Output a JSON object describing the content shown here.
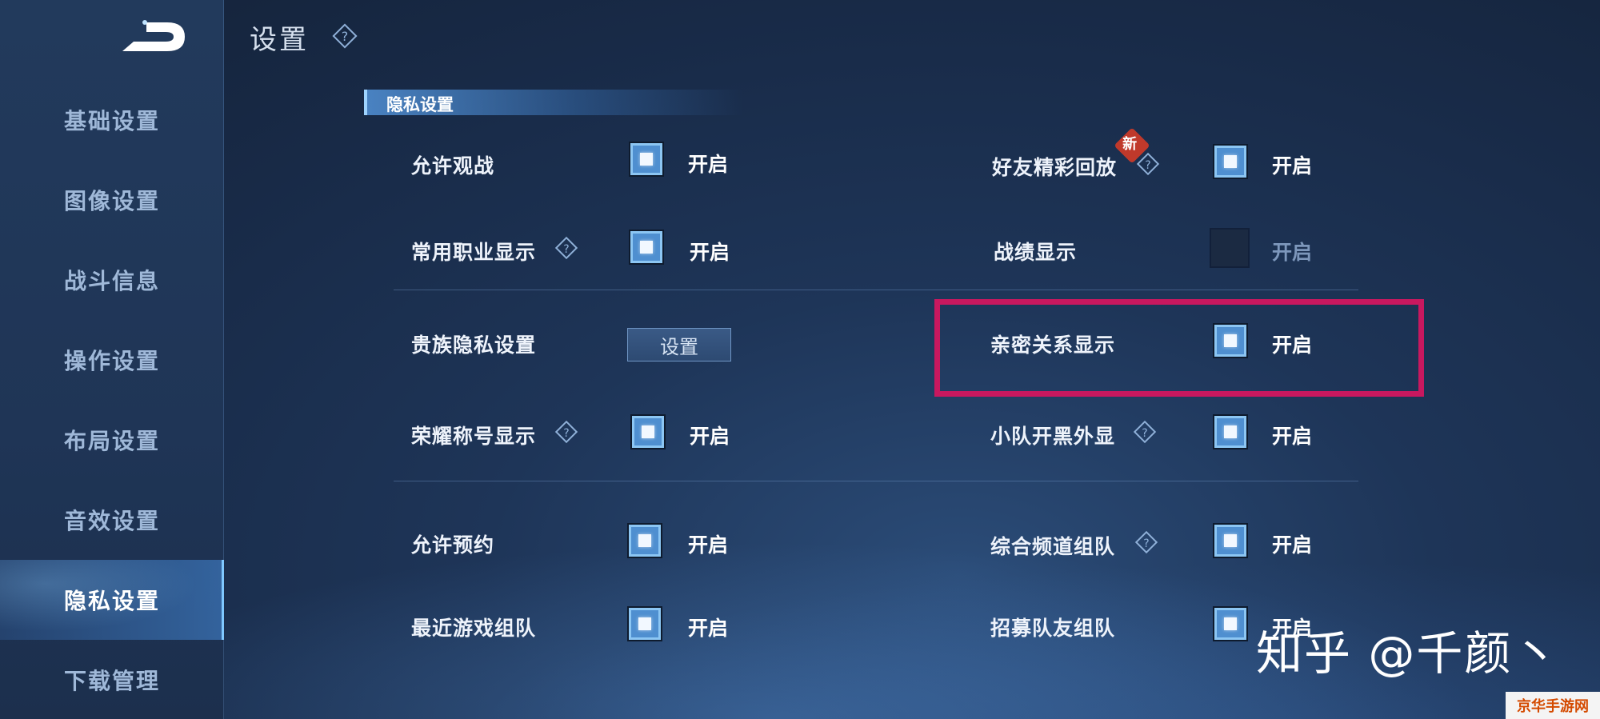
{
  "header": {
    "title": "设置"
  },
  "sidebar": {
    "items": [
      {
        "label": "基础设置"
      },
      {
        "label": "图像设置"
      },
      {
        "label": "战斗信息"
      },
      {
        "label": "操作设置"
      },
      {
        "label": "布局设置"
      },
      {
        "label": "音效设置"
      },
      {
        "label": "隐私设置",
        "active": true
      },
      {
        "label": "下载管理"
      }
    ]
  },
  "section": {
    "title": "隐私设置"
  },
  "settings": {
    "allow_spectate": {
      "label": "允许观战",
      "state": "开启",
      "checked": true
    },
    "friend_replay": {
      "label": "好友精彩回放",
      "state": "开启",
      "checked": true,
      "badge": "新"
    },
    "common_class": {
      "label": "常用职业显示",
      "state": "开启",
      "checked": true
    },
    "record_display": {
      "label": "战绩显示",
      "state": "开启",
      "checked": false
    },
    "noble_privacy": {
      "label": "贵族隐私设置",
      "button": "设置"
    },
    "intimacy_display": {
      "label": "亲密关系显示",
      "state": "开启",
      "checked": true
    },
    "honor_title": {
      "label": "荣耀称号显示",
      "state": "开启",
      "checked": true
    },
    "team_black": {
      "label": "小队开黑外显",
      "state": "开启",
      "checked": true
    },
    "allow_reserve": {
      "label": "允许预约",
      "state": "开启",
      "checked": true
    },
    "channel_team": {
      "label": "综合频道组队",
      "state": "开启",
      "checked": true
    },
    "recent_team": {
      "label": "最近游戏组队",
      "state": "开启",
      "checked": true
    },
    "recruit_team": {
      "label": "招募队友组队",
      "state": "开启",
      "checked": true
    }
  },
  "overlay": {
    "watermark": "知乎 @千颜丶",
    "corner_mark": "京华手游网",
    "highlight_color": "#c8185f"
  },
  "icons": [
    "back-arrow-icon",
    "help-diamond-icon",
    "new-badge-icon"
  ]
}
